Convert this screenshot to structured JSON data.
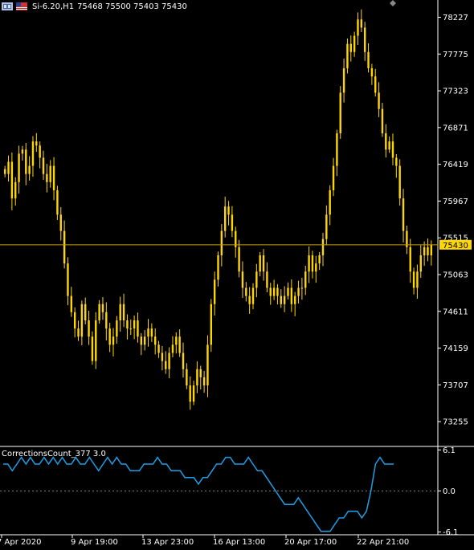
{
  "header": {
    "symbol": "Si-6.20,H1",
    "ohlc": "75468 75500 75403 75430"
  },
  "indicator": {
    "title": "CorrectionsCount_377 3.0"
  },
  "colors": {
    "background": "#000000",
    "candle": "#ffd700",
    "price_line": "#c8a000",
    "price_badge": "#ffd700",
    "indicator_line": "#1e9fe6",
    "axis": "#ffffff",
    "zero_line": "#808080"
  },
  "chart_data": [
    {
      "type": "candlestick",
      "title": "Si-6.20,H1",
      "y_ticks": [
        78227,
        77775,
        77323,
        76871,
        76419,
        75967,
        75515,
        75063,
        74611,
        74159,
        73707,
        73255
      ],
      "ylim": [
        72950,
        78400
      ],
      "x_ticks": [
        "7 Apr 2020",
        "9 Apr 19:00",
        "13 Apr 23:00",
        "16 Apr 13:00",
        "20 Apr 17:00",
        "22 Apr 21:00"
      ],
      "current_price": 75430,
      "price_label": "75430",
      "closes": [
        76300,
        76450,
        76000,
        76200,
        76550,
        76600,
        76300,
        76400,
        76700,
        76650,
        76500,
        76300,
        76200,
        76400,
        76100,
        75800,
        75600,
        75200,
        74800,
        74600,
        74400,
        74300,
        74700,
        74500,
        74300,
        74000,
        74500,
        74700,
        74600,
        74400,
        74200,
        74300,
        74500,
        74700,
        74500,
        74400,
        74400,
        74500,
        74300,
        74200,
        74300,
        74400,
        74300,
        74200,
        74100,
        74000,
        73900,
        74100,
        74200,
        74300,
        74100,
        73900,
        73700,
        73500,
        73700,
        73900,
        73800,
        73700,
        74200,
        74700,
        75000,
        75300,
        75600,
        75900,
        75800,
        75600,
        75400,
        75100,
        74900,
        74800,
        74700,
        74900,
        75100,
        75300,
        75100,
        74900,
        74800,
        74900,
        74800,
        74700,
        74800,
        74900,
        74700,
        74800,
        74900,
        74900,
        75100,
        75300,
        75100,
        75200,
        75300,
        75500,
        75800,
        76100,
        76400,
        76800,
        77300,
        77600,
        77900,
        77800,
        78000,
        78200,
        78100,
        77800,
        77600,
        77500,
        77300,
        77100,
        76800,
        76600,
        76700,
        76500,
        76400,
        76000,
        75600,
        75400,
        75100,
        74900,
        75100,
        75300,
        75400,
        75300,
        75430
      ],
      "series": [
        {
          "name": "CorrectionsCount_377 3.0",
          "type": "line",
          "y_ticks": [
            6.1,
            0.0,
            -6.1
          ],
          "y_tick_labels": [
            "6.1",
            "0.0",
            "-6.1"
          ],
          "ylim": [
            -6.5,
            6.5
          ],
          "values": [
            4,
            4,
            3,
            4,
            5,
            4,
            5,
            4,
            4,
            5,
            4,
            5,
            4,
            5,
            4,
            4,
            5,
            4,
            4,
            5,
            4,
            3,
            4,
            5,
            4,
            5,
            4,
            4,
            3,
            3,
            3,
            4,
            4,
            4,
            5,
            4,
            4,
            3,
            3,
            3,
            2,
            2,
            2,
            1,
            2,
            2,
            3,
            4,
            4,
            5,
            5,
            4,
            4,
            4,
            5,
            4,
            3,
            3,
            2,
            1,
            0,
            -1,
            -2,
            -2,
            -2,
            -1,
            -2,
            -3,
            -4,
            -5,
            -6,
            -6,
            -6,
            -5,
            -4,
            -4,
            -3,
            -3,
            -3,
            -4,
            -3,
            0,
            4,
            5,
            4,
            4,
            4
          ]
        }
      ]
    }
  ]
}
